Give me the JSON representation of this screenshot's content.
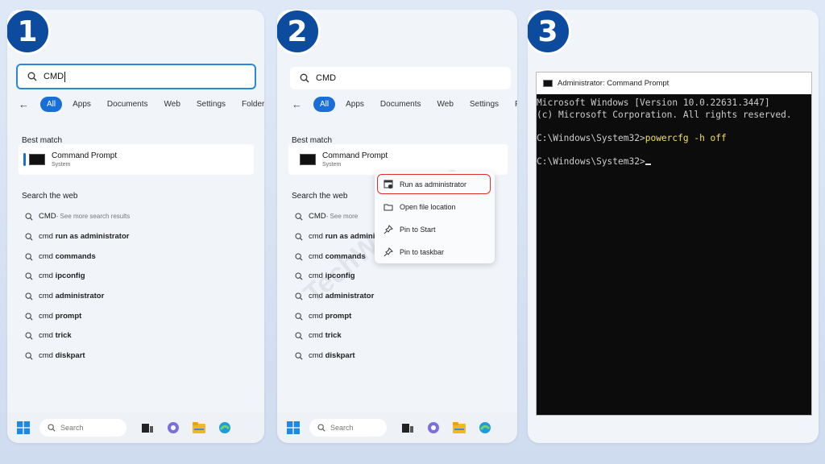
{
  "steps": [
    "1",
    "2",
    "3"
  ],
  "search": {
    "query": "CMD"
  },
  "filters": {
    "items": [
      "All",
      "Apps",
      "Documents",
      "Web",
      "Settings",
      "Folders"
    ]
  },
  "best_match": {
    "heading": "Best match",
    "title": "Command Prompt",
    "subtitle": "System"
  },
  "web": {
    "heading": "Search the web",
    "first": {
      "query": "CMD",
      "suffix": " - See more search results"
    },
    "first_short_suffix": " - See more",
    "results": [
      {
        "prefix": "cmd ",
        "bold": "run as administrator"
      },
      {
        "prefix": "cmd ",
        "bold": "commands"
      },
      {
        "prefix": "cmd ",
        "bold": "ipconfig"
      },
      {
        "prefix": "cmd ",
        "bold": "administrator"
      },
      {
        "prefix": "cmd ",
        "bold": "prompt"
      },
      {
        "prefix": "cmd ",
        "bold": "trick"
      },
      {
        "prefix": "cmd ",
        "bold": "diskpart"
      }
    ],
    "second_truncated": "run as admini"
  },
  "taskbar": {
    "search_placeholder": "Search"
  },
  "context_menu": {
    "items": [
      "Run as administrator",
      "Open file location",
      "Pin to Start",
      "Pin to taskbar"
    ]
  },
  "watermark": "TechWalls.com",
  "terminal": {
    "title": "Administrator: Command Prompt",
    "line1": "Microsoft Windows [Version 10.0.22631.3447]",
    "line2": "(c) Microsoft Corporation. All rights reserved.",
    "prompt": "C:\\Windows\\System32>",
    "command": "powercfg -h off"
  },
  "colors": {
    "accent": "#1a6fd6",
    "step_badge": "#0d4b9e",
    "highlight": "#e0302b",
    "command_text": "#f2e15a"
  }
}
